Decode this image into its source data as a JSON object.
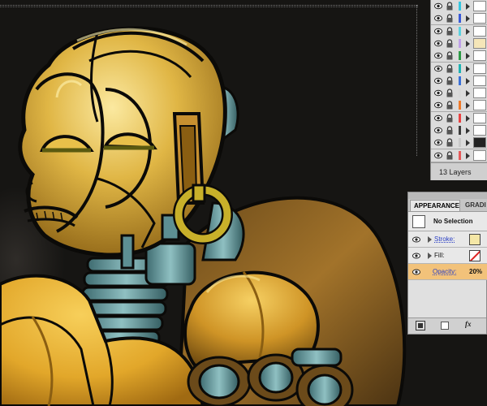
{
  "layers_panel": {
    "layer_swatch_colors": [
      "#36c6e0",
      "#3a5ad8",
      "#5bd2e0",
      "#bfa1e8",
      "#2c9a46",
      "#1fb3b3",
      "#3a70d8",
      "#d8d8d8",
      "#ef7a2a",
      "#ea4242",
      "#3c3c3c",
      "#c9c9c9",
      "#e65a5a"
    ],
    "layer_count_label": "13 Layers"
  },
  "appearance_panel": {
    "tab_active": "APPEARANCE",
    "tab_inactive": "GRADI",
    "selection_label": "No Selection",
    "stroke_label": "Stroke:",
    "fill_label": "Fill:",
    "opacity_label": "Opacity:",
    "opacity_value": "20%",
    "fx_label": "fx",
    "stroke_color": "#f4e7a6",
    "opacity_row_color": "#f2c27a"
  },
  "artwork": {
    "subject": "gold-robot-illustration",
    "colors": {
      "gold": "#d9a92a",
      "gold_light": "#f3d46a",
      "gold_dark": "#8a5e12",
      "teal_metal": "#5d8f93",
      "outline": "#0b0a08",
      "background": "#161513"
    }
  }
}
